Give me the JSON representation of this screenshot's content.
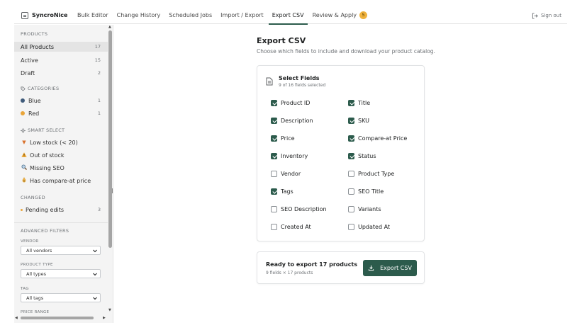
{
  "app": {
    "name": "SyncroNice"
  },
  "nav": {
    "tabs": [
      "Bulk Editor",
      "Change History",
      "Scheduled Jobs",
      "Import / Export",
      "Export CSV",
      "Review & Apply"
    ],
    "active_tab": "Export CSV",
    "review_badge": "5",
    "signout": "Sign out"
  },
  "sidebar": {
    "products_title": "PRODUCTS",
    "products": [
      {
        "label": "All Products",
        "count": "17"
      },
      {
        "label": "Active",
        "count": "15"
      },
      {
        "label": "Draft",
        "count": "2"
      }
    ],
    "categories_title": "CATEGORIES",
    "categories": [
      {
        "label": "Blue",
        "count": "1",
        "color": "#3f5b7a"
      },
      {
        "label": "Red",
        "count": "1",
        "color": "#e9a53a"
      }
    ],
    "smart_title": "SMART SELECT",
    "smart": [
      {
        "label": "Low stock (< 20)",
        "icon": "down-triangle-icon"
      },
      {
        "label": "Out of stock",
        "icon": "warning-icon"
      },
      {
        "label": "Missing SEO",
        "icon": "magnifier-icon"
      },
      {
        "label": "Has compare-at price",
        "icon": "money-bag-icon"
      }
    ],
    "changed_title": "CHANGED",
    "changed": [
      {
        "label": "Pending edits",
        "count": "3"
      }
    ],
    "advanced_title": "ADVANCED FILTERS",
    "filters": [
      {
        "label": "VENDOR",
        "value": "All vendors"
      },
      {
        "label": "PRODUCT TYPE",
        "value": "All types"
      },
      {
        "label": "TAG",
        "value": "All tags"
      }
    ],
    "price_range_label": "PRICE RANGE"
  },
  "main": {
    "title": "Export CSV",
    "subtitle": "Choose which fields to include and download your product catalog.",
    "fields_card": {
      "title": "Select Fields",
      "subtitle": "9 of 16 fields selected",
      "fields": [
        {
          "label": "Product ID",
          "checked": true
        },
        {
          "label": "Title",
          "checked": true
        },
        {
          "label": "Description",
          "checked": true
        },
        {
          "label": "SKU",
          "checked": true
        },
        {
          "label": "Price",
          "checked": true
        },
        {
          "label": "Compare-at Price",
          "checked": true
        },
        {
          "label": "Inventory",
          "checked": true
        },
        {
          "label": "Status",
          "checked": true
        },
        {
          "label": "Vendor",
          "checked": false
        },
        {
          "label": "Product Type",
          "checked": false
        },
        {
          "label": "Tags",
          "checked": true
        },
        {
          "label": "SEO Title",
          "checked": false
        },
        {
          "label": "SEO Description",
          "checked": false
        },
        {
          "label": "Variants",
          "checked": false
        },
        {
          "label": "Created At",
          "checked": false
        },
        {
          "label": "Updated At",
          "checked": false
        }
      ]
    },
    "export_card": {
      "title": "Ready to export 17 products",
      "subtitle": "9 fields × 17 products",
      "button": "Export CSV"
    }
  },
  "colors": {
    "accent": "#2c5b4c",
    "badge": "#f0b33e"
  }
}
